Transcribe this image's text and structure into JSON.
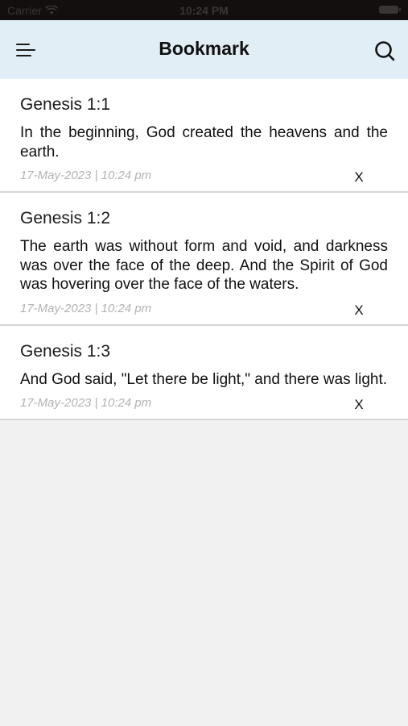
{
  "status_bar": {
    "carrier": "Carrier",
    "time": "10:24 PM"
  },
  "header": {
    "title": "Bookmark",
    "menu_icon": "menu-icon",
    "search_icon": "search-icon"
  },
  "bookmarks": [
    {
      "reference": "Genesis 1:1",
      "text": "In the beginning, God created the heavens and the earth.",
      "date": "17-May-2023 | 10:24 pm",
      "remove_label": "X"
    },
    {
      "reference": "Genesis 1:2",
      "text": "The earth was without form and void, and darkness was over the face of the deep. And the Spirit of God was hovering over the face of the waters.",
      "date": "17-May-2023 | 10:24 pm",
      "remove_label": "X"
    },
    {
      "reference": "Genesis 1:3",
      "text": "And God said, \"Let there be light,\" and there was light.",
      "date": "17-May-2023 | 10:24 pm",
      "remove_label": "X"
    }
  ],
  "colors": {
    "header_background": "#e2eef6",
    "page_background": "#f1f1f1",
    "date_text": "#b3b3b3"
  }
}
